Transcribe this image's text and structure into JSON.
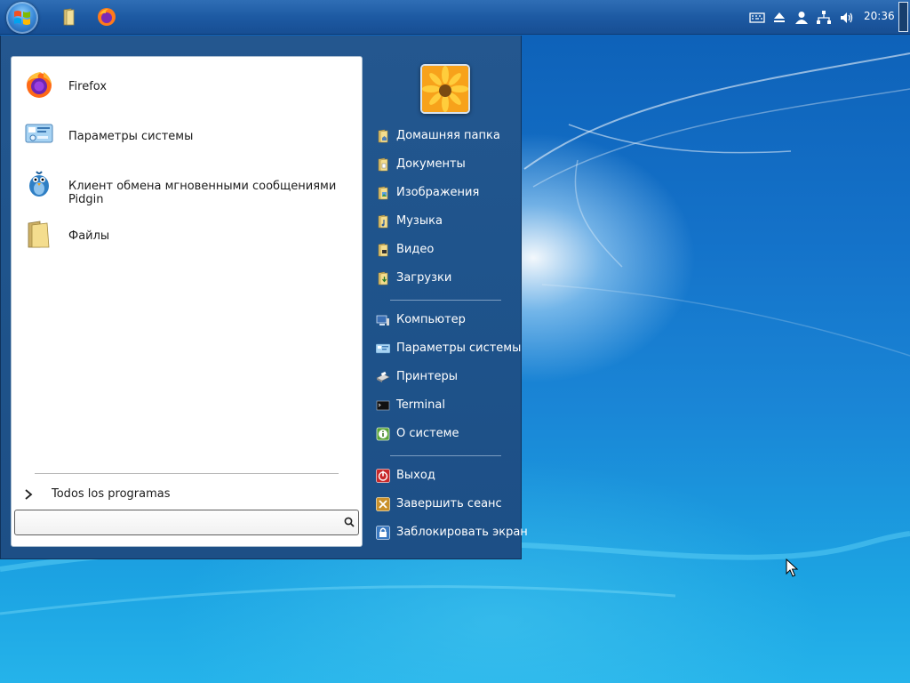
{
  "taskbar": {
    "pinned": [
      {
        "name": "files-pinned-icon"
      },
      {
        "name": "firefox-pinned-icon"
      }
    ],
    "tray": [
      "keyboard-icon",
      "eject-icon",
      "user-icon",
      "network-icon",
      "volume-icon"
    ],
    "clock": "20:36"
  },
  "start_menu": {
    "apps": [
      {
        "label": "Firefox",
        "icon": "firefox-icon"
      },
      {
        "label": "Параметры системы",
        "icon": "settings-icon"
      },
      {
        "label": "Клиент обмена мгновенными сообщениями Pidgin",
        "icon": "pidgin-icon"
      },
      {
        "label": "Файлы",
        "icon": "folder-icon"
      }
    ],
    "all_programs": "Todos los programas",
    "search": {
      "value": "",
      "placeholder": ""
    },
    "places": [
      {
        "label": "Домашняя папка",
        "icon": "home-folder-icon"
      },
      {
        "label": "Документы",
        "icon": "documents-folder-icon"
      },
      {
        "label": "Изображения",
        "icon": "pictures-folder-icon"
      },
      {
        "label": "Музыка",
        "icon": "music-folder-icon"
      },
      {
        "label": "Видео",
        "icon": "video-folder-icon"
      },
      {
        "label": "Загрузки",
        "icon": "downloads-folder-icon"
      }
    ],
    "system": [
      {
        "label": "Компьютер",
        "icon": "computer-icon"
      },
      {
        "label": "Параметры системы",
        "icon": "settings-icon"
      },
      {
        "label": "Принтеры",
        "icon": "printer-icon"
      },
      {
        "label": "Terminal",
        "icon": "terminal-icon"
      },
      {
        "label": "О системе",
        "icon": "info-icon"
      }
    ],
    "session": [
      {
        "label": "Выход",
        "icon": "logout-icon"
      },
      {
        "label": "Завершить сеанс",
        "icon": "end-session-icon"
      },
      {
        "label": "Заблокировать экран",
        "icon": "lock-icon"
      }
    ]
  },
  "colors": {
    "taskbar": "#1d5aa3",
    "menu_right_pane": "#1f548c",
    "desktop": "#1a86d6"
  }
}
